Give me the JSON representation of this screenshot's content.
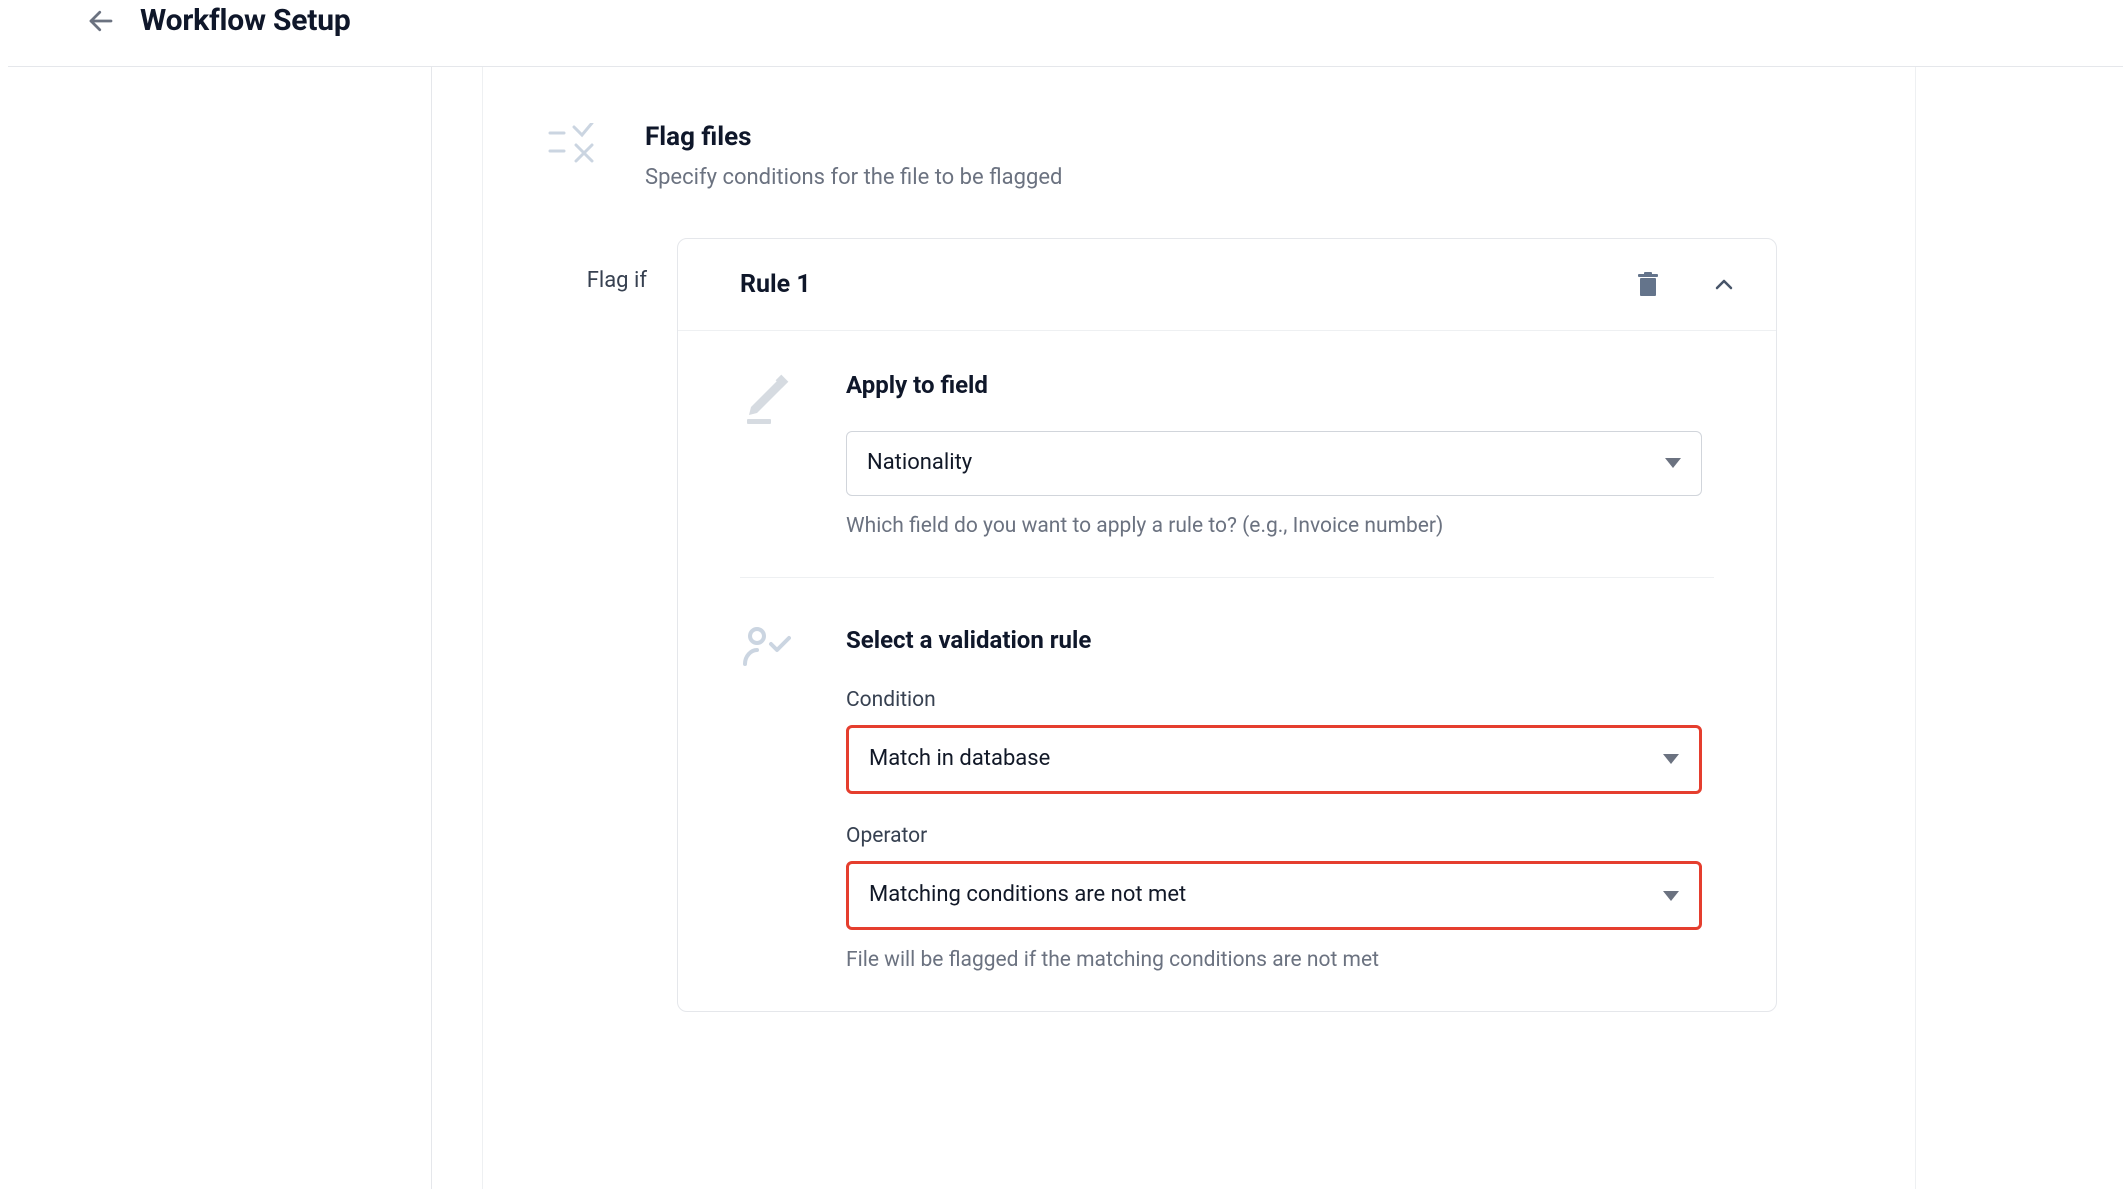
{
  "header": {
    "title": "Workflow Setup"
  },
  "section": {
    "title": "Flag files",
    "description": "Specify conditions for the file to be flagged"
  },
  "flag_if_label": "Flag if",
  "rule": {
    "title": "Rule 1",
    "apply": {
      "heading": "Apply to field",
      "field_select_value": "Nationality",
      "help": "Which field do you want to apply a rule to? (e.g., Invoice number)"
    },
    "validation": {
      "heading": "Select a validation rule",
      "condition_label": "Condition",
      "condition_value": "Match in database",
      "operator_label": "Operator",
      "operator_value": "Matching conditions are not met",
      "operator_help": "File will be flagged if the matching conditions are not met"
    }
  }
}
